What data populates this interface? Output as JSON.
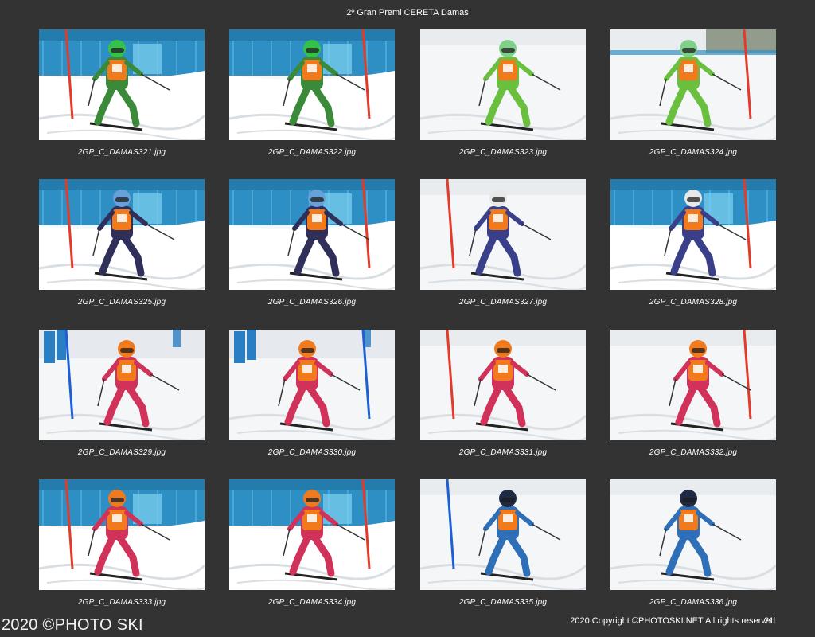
{
  "header": {
    "title": "2º Gran Premi CERETA Damas"
  },
  "contact_sheet": {
    "photos": [
      {
        "filename": "2GP_C_DAMAS321.jpg",
        "backdrop": "blue-fence",
        "helmet": "#35c24a",
        "bib": "#f07a1c",
        "suit": "#3b8a3a",
        "pole": "red"
      },
      {
        "filename": "2GP_C_DAMAS322.jpg",
        "backdrop": "blue-fence",
        "helmet": "#35c24a",
        "bib": "#f07a1c",
        "suit": "#3b8a3a",
        "pole": "red"
      },
      {
        "filename": "2GP_C_DAMAS323.jpg",
        "backdrop": "snow",
        "helmet": "#7fd18a",
        "bib": "#f07a1c",
        "suit": "#6abf3f",
        "pole": "none"
      },
      {
        "filename": "2GP_C_DAMAS324.jpg",
        "backdrop": "snow-fence",
        "helmet": "#7fd18a",
        "bib": "#f07a1c",
        "suit": "#6abf3f",
        "pole": "red"
      },
      {
        "filename": "2GP_C_DAMAS325.jpg",
        "backdrop": "blue-fence",
        "helmet": "#6aa0d8",
        "bib": "#f07a1c",
        "suit": "#2f2f5a",
        "pole": "red"
      },
      {
        "filename": "2GP_C_DAMAS326.jpg",
        "backdrop": "blue-fence",
        "helmet": "#6aa0d8",
        "bib": "#f07a1c",
        "suit": "#2f2f5a",
        "pole": "red"
      },
      {
        "filename": "2GP_C_DAMAS327.jpg",
        "backdrop": "snow",
        "helmet": "#e8e8e8",
        "bib": "#f07a1c",
        "suit": "#3a3f8a",
        "pole": "red"
      },
      {
        "filename": "2GP_C_DAMAS328.jpg",
        "backdrop": "blue-fence",
        "helmet": "#e8e8e8",
        "bib": "#f07a1c",
        "suit": "#3a3f8a",
        "pole": "red"
      },
      {
        "filename": "2GP_C_DAMAS329.jpg",
        "backdrop": "snow-spectators",
        "helmet": "#f07a1c",
        "bib": "#f07a1c",
        "suit": "#d0325a",
        "pole": "blue"
      },
      {
        "filename": "2GP_C_DAMAS330.jpg",
        "backdrop": "snow-spectators",
        "helmet": "#f07a1c",
        "bib": "#f07a1c",
        "suit": "#d0325a",
        "pole": "blue"
      },
      {
        "filename": "2GP_C_DAMAS331.jpg",
        "backdrop": "snow",
        "helmet": "#f07a1c",
        "bib": "#f07a1c",
        "suit": "#d0325a",
        "pole": "red"
      },
      {
        "filename": "2GP_C_DAMAS332.jpg",
        "backdrop": "snow",
        "helmet": "#f07a1c",
        "bib": "#f07a1c",
        "suit": "#d0325a",
        "pole": "red"
      },
      {
        "filename": "2GP_C_DAMAS333.jpg",
        "backdrop": "blue-fence",
        "helmet": "#f07a1c",
        "bib": "#f07a1c",
        "suit": "#d0325a",
        "pole": "red"
      },
      {
        "filename": "2GP_C_DAMAS334.jpg",
        "backdrop": "blue-fence",
        "helmet": "#f07a1c",
        "bib": "#f07a1c",
        "suit": "#d0325a",
        "pole": "red"
      },
      {
        "filename": "2GP_C_DAMAS335.jpg",
        "backdrop": "snow",
        "helmet": "#1f2a44",
        "bib": "#f07a1c",
        "suit": "#2f6fb8",
        "pole": "blue"
      },
      {
        "filename": "2GP_C_DAMAS336.jpg",
        "backdrop": "snow",
        "helmet": "#1f2a44",
        "bib": "#f07a1c",
        "suit": "#2f6fb8",
        "pole": "none"
      }
    ]
  },
  "footer": {
    "watermark": "2020 ©PHOTO SKI",
    "copyright": "2020 Copyright ©PHOTOSKI.NET All rights reserved",
    "page_number": "21"
  },
  "colors": {
    "background": "#333333",
    "text": "#ffffff",
    "fence_blue": "#2d8fc4",
    "snow": "#f4f6f8"
  }
}
